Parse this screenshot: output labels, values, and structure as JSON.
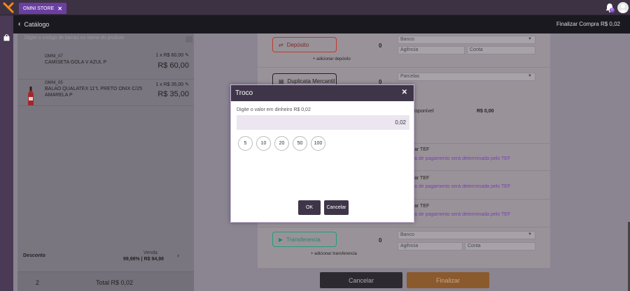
{
  "app": {
    "tab_label": "OMNI STORE",
    "notification_count": "0"
  },
  "header": {
    "back_label": "Catálogo",
    "finalizar_compra": "Finalizar Compra   R$ 0,02"
  },
  "cart": {
    "search_placeholder": "Digite o código de barras ou nome do produto",
    "items": [
      {
        "code": "OMNI_07",
        "name": "CAMISETA GOLA V AZUL P",
        "qty": "1 x R$ 60,00",
        "price": "R$ 60,00"
      },
      {
        "code": "OMNI_05",
        "name": "BALAO QUALATEX 11\"L PRETO ONIX C/25 AMARELA P",
        "qty": "1 x R$ 35,00",
        "price": "R$ 35,00"
      }
    ],
    "desconto_label": "Desconto",
    "venda_label": "Venda",
    "venda_value": "99,98% | R$ 94,98",
    "total_count": "2",
    "total_label": "Total R$ 0,02"
  },
  "payments": {
    "deposito": {
      "label": "Depósito",
      "value": "0",
      "add": "adicionar depósito",
      "banco": "Banco",
      "agencia": "Agência",
      "conta": "Conta"
    },
    "duplicata": {
      "label": "Duplicata Mercantil",
      "value": "0",
      "parcelas": "Parcelas"
    },
    "disponivel_label": "isponível",
    "disponivel_value": "R$ 0,00",
    "tef_rows": [
      {
        "a": "ar TEF",
        "b": "a de pagamento será determinada pelo TEF"
      },
      {
        "a": "ar TEF",
        "b": "a de pagamento será determinada pelo TEF"
      },
      {
        "a": "ar TEF",
        "b": "a de pagamento será determinada pelo TEF"
      }
    ],
    "transferencia": {
      "label": "Transferencia",
      "value": "0",
      "add": "adicionar transferencia",
      "banco": "Banco",
      "agencia": "Agência",
      "conta": "Conta"
    }
  },
  "footer": {
    "cancel": "Cancelar",
    "finalizar": "Finalizar"
  },
  "modal": {
    "title": "Troco",
    "label": "Digite o valor em dinheiro R$ 0,02",
    "input_value": "0,02",
    "chips": [
      "5",
      "10",
      "20",
      "50",
      "100"
    ],
    "ok": "OK",
    "cancel": "Cancelar"
  },
  "colors": {
    "accent": "#6b3fa0",
    "deposito_border": "#c0392b",
    "transferencia_border": "#1e9e7a"
  }
}
